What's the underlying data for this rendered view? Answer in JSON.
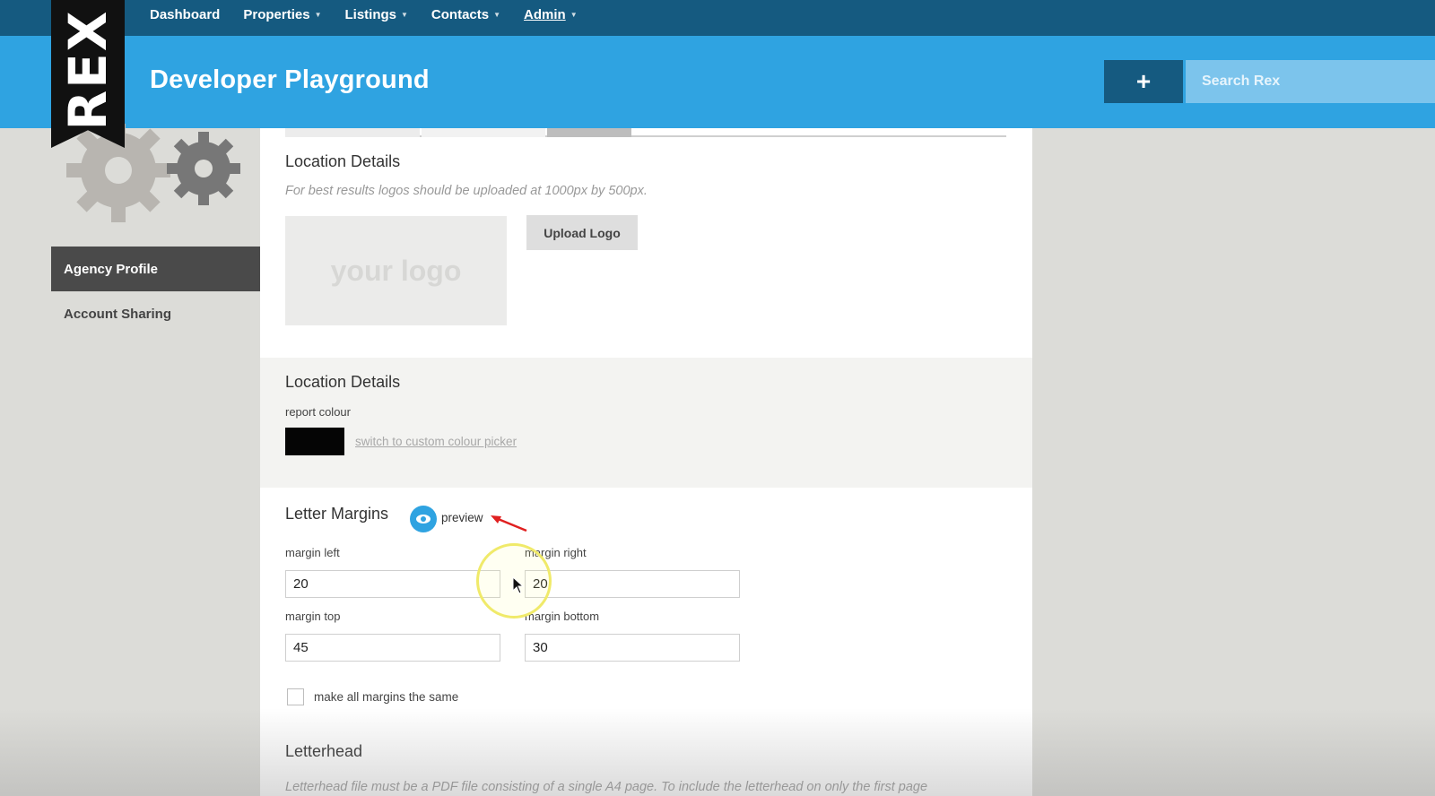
{
  "nav": {
    "items": [
      {
        "label": "Dashboard",
        "caret": false,
        "active": false
      },
      {
        "label": "Properties",
        "caret": true,
        "active": false
      },
      {
        "label": "Listings",
        "caret": true,
        "active": false
      },
      {
        "label": "Contacts",
        "caret": true,
        "active": false
      },
      {
        "label": "Admin",
        "caret": true,
        "active": true
      }
    ]
  },
  "brand": {
    "logo_text": "REX"
  },
  "header": {
    "title": "Developer Playground",
    "add_symbol": "+",
    "search_placeholder": "Search Rex"
  },
  "sidebar": {
    "items": [
      {
        "label": "Agency Profile",
        "active": true
      },
      {
        "label": "Account Sharing",
        "active": false
      }
    ]
  },
  "logo_section": {
    "title": "Location Details",
    "hint": "For best results logos should be uploaded at 1000px by 500px.",
    "placeholder": "your logo",
    "upload_label": "Upload Logo"
  },
  "colour_section": {
    "title": "Location Details",
    "report_colour_label": "report colour",
    "swatch_color": "#050505",
    "link_label": "switch to custom colour picker"
  },
  "margins_section": {
    "title": "Letter Margins",
    "preview_label": "preview",
    "margin_left_label": "margin left",
    "margin_left": "20",
    "margin_right_label": "margin right",
    "margin_right": "20",
    "margin_top_label": "margin top",
    "margin_top": "45",
    "margin_bottom_label": "margin bottom",
    "margin_bottom": "30",
    "same_label": "make all margins the same"
  },
  "letterhead_section": {
    "title": "Letterhead",
    "hint": "Letterhead file must be a PDF file consisting of a single A4 page. To include the letterhead on only the first page"
  },
  "colors": {
    "nav_bg": "#155a80",
    "header_bg": "#2fa3e1",
    "accent": "#2fa3e1"
  }
}
